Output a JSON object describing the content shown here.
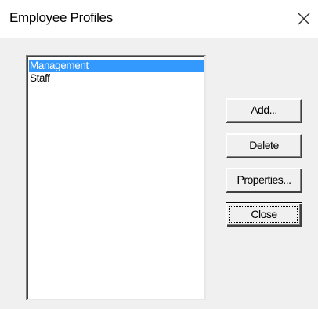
{
  "window": {
    "title": "Employee Profiles",
    "close_icon": "close-icon"
  },
  "profiles": {
    "items": [
      {
        "label": "Management",
        "selected": true
      },
      {
        "label": "Staff",
        "selected": false
      }
    ]
  },
  "buttons": {
    "add_label": "Add...",
    "delete_label": "Delete",
    "properties_label": "Properties...",
    "close_label": "Close"
  },
  "colors": {
    "selection": "#3399ff",
    "dialog_face": "#f0f0f0",
    "titlebar": "#ffffff"
  }
}
